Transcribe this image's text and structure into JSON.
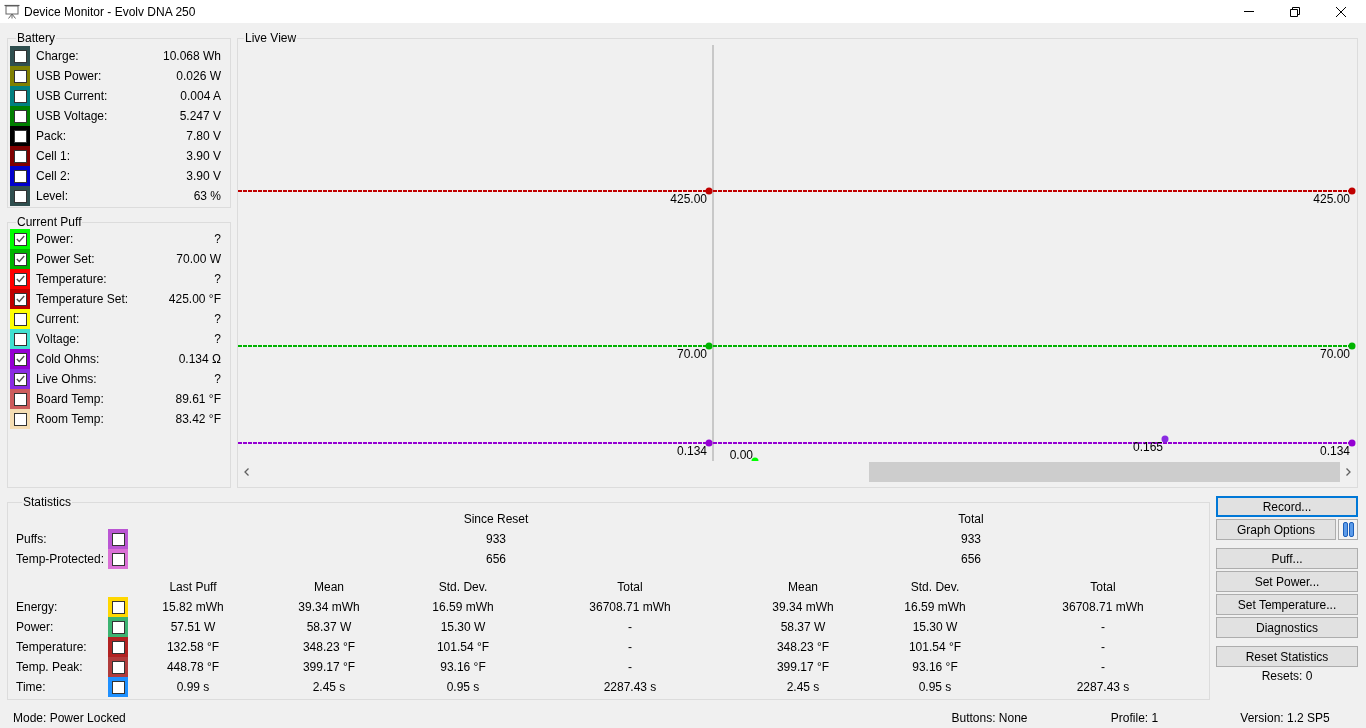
{
  "window": {
    "title": "Device Monitor - Evolv DNA 250"
  },
  "battery": {
    "title": "Battery",
    "items": [
      {
        "label": "Charge:",
        "value": "10.068 Wh",
        "color": "#2f4f4f",
        "checked": false
      },
      {
        "label": "USB Power:",
        "value": "0.026 W",
        "color": "#808000",
        "checked": false
      },
      {
        "label": "USB Current:",
        "value": "0.004 A",
        "color": "#008080",
        "checked": false
      },
      {
        "label": "USB Voltage:",
        "value": "5.247 V",
        "color": "#008000",
        "checked": false
      },
      {
        "label": "Pack:",
        "value": "7.80 V",
        "color": "#000000",
        "checked": false
      },
      {
        "label": "Cell 1:",
        "value": "3.90 V",
        "color": "#800000",
        "checked": false
      },
      {
        "label": "Cell 2:",
        "value": "3.90 V",
        "color": "#0000cd",
        "checked": false
      },
      {
        "label": "Level:",
        "value": "63 %",
        "color": "#2f4f4f",
        "checked": false
      }
    ]
  },
  "current_puff": {
    "title": "Current Puff",
    "items": [
      {
        "label": "Power:",
        "value": "?",
        "color": "#00ff00",
        "checked": true
      },
      {
        "label": "Power Set:",
        "value": "70.00 W",
        "color": "#00b400",
        "checked": true
      },
      {
        "label": "Temperature:",
        "value": "?",
        "color": "#ff0000",
        "checked": true
      },
      {
        "label": "Temperature Set:",
        "value": "425.00 °F",
        "color": "#c00000",
        "checked": true
      },
      {
        "label": "Current:",
        "value": "?",
        "color": "#ffff00",
        "checked": false
      },
      {
        "label": "Voltage:",
        "value": "?",
        "color": "#40e0d0",
        "checked": false
      },
      {
        "label": "Cold Ohms:",
        "value": "0.134 Ω",
        "color": "#9400d3",
        "checked": true
      },
      {
        "label": "Live Ohms:",
        "value": "?",
        "color": "#8a2be2",
        "checked": true
      },
      {
        "label": "Board Temp:",
        "value": "89.61 °F",
        "color": "#cd5c5c",
        "checked": false
      },
      {
        "label": "Room Temp:",
        "value": "83.42 °F",
        "color": "#f5deb3",
        "checked": false
      }
    ]
  },
  "live_view": {
    "title": "Live View",
    "traces": [
      {
        "kind": "line",
        "color": "#c00000",
        "labels": [
          "425.00",
          "425.00"
        ]
      },
      {
        "kind": "line",
        "color": "#00b400",
        "labels": [
          "70.00",
          "70.00"
        ]
      },
      {
        "kind": "point",
        "color": "#00ff00",
        "labels": [
          "0.00"
        ]
      },
      {
        "kind": "line",
        "color": "#9400d3",
        "labels": [
          "0.134",
          "0.134"
        ]
      },
      {
        "kind": "point",
        "color": "#8a2be2",
        "labels": [
          "0.165"
        ]
      }
    ]
  },
  "statistics": {
    "title": "Statistics",
    "group_headers": [
      "Since Reset",
      "Total"
    ],
    "counters": [
      {
        "label": "Puffs:",
        "color": "#ba55d3",
        "checked": false,
        "since_reset": "933",
        "total": "933"
      },
      {
        "label": "Temp-Protected:",
        "color": "#da70d6",
        "checked": false,
        "since_reset": "656",
        "total": "656"
      }
    ],
    "columns": [
      "Last Puff",
      "Mean",
      "Std. Dev.",
      "Total",
      "Mean",
      "Std. Dev.",
      "Total"
    ],
    "rows": [
      {
        "label": "Energy:",
        "color": "#ffd700",
        "checked": false,
        "cells": [
          "15.82 mWh",
          "39.34 mWh",
          "16.59 mWh",
          "36708.71 mWh",
          "39.34 mWh",
          "16.59 mWh",
          "36708.71 mWh"
        ]
      },
      {
        "label": "Power:",
        "color": "#3cb371",
        "checked": false,
        "cells": [
          "57.51 W",
          "58.37 W",
          "15.30 W",
          "-",
          "58.37 W",
          "15.30 W",
          "-"
        ]
      },
      {
        "label": "Temperature:",
        "color": "#b22222",
        "checked": false,
        "cells": [
          "132.58 °F",
          "348.23 °F",
          "101.54 °F",
          "-",
          "348.23 °F",
          "101.54 °F",
          "-"
        ]
      },
      {
        "label": "Temp. Peak:",
        "color": "#b03c3c",
        "checked": false,
        "cells": [
          "448.78 °F",
          "399.17 °F",
          "93.16 °F",
          "-",
          "399.17 °F",
          "93.16 °F",
          "-"
        ]
      },
      {
        "label": "Time:",
        "color": "#1e90ff",
        "checked": false,
        "cells": [
          "0.99 s",
          "2.45 s",
          "0.95 s",
          "2287.43 s",
          "2.45 s",
          "0.95 s",
          "2287.43 s"
        ]
      }
    ]
  },
  "controls": {
    "groups": [
      {
        "buttons": [
          {
            "label": "Record...",
            "kind": "plain",
            "focused": true
          },
          {
            "label": "Graph Options",
            "kind": "with-pause",
            "focused": false
          }
        ]
      },
      {
        "buttons": [
          {
            "label": "Puff...",
            "kind": "plain",
            "focused": false
          },
          {
            "label": "Set Power...",
            "kind": "plain",
            "focused": false
          },
          {
            "label": "Set Temperature...",
            "kind": "plain",
            "focused": false
          },
          {
            "label": "Diagnostics",
            "kind": "plain",
            "focused": false
          }
        ]
      },
      {
        "buttons": [
          {
            "label": "Reset Statistics",
            "kind": "plain",
            "focused": false
          }
        ]
      }
    ],
    "resets": "Resets: 0"
  },
  "status_bar": [
    "Mode: Power Locked",
    "Buttons: None",
    "Profile: 1",
    "Version: 1.2 SP5"
  ]
}
